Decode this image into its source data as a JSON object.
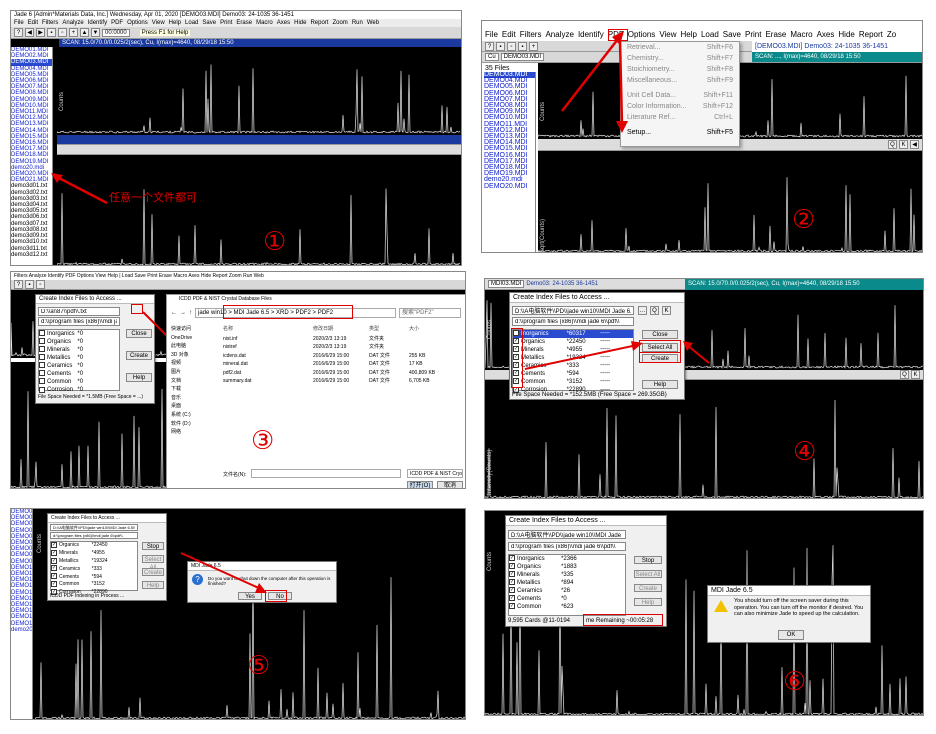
{
  "colors": {
    "annotation": "#e00000",
    "plot_bg": "#000000",
    "list_selected": "#2a4bd0"
  },
  "icons": [
    "red-arrow-icon",
    "warning-icon",
    "question-icon",
    "folder-icon",
    "checkbox-icon"
  ],
  "p1": {
    "title": "Jade 6 [Admin*Materials Data, Inc.] Wednesday, Apr 01, 2020 [DEMO03.MDI] Demo03: 24-1035 36-1451",
    "menu": [
      "File",
      "Edit",
      "Filters",
      "Analyze",
      "Identify",
      "PDF",
      "Options",
      "View",
      "Help",
      "Load",
      "Save",
      "Print",
      "Erase",
      "Macro",
      "Axes",
      "Hide",
      "Report",
      "Zoom",
      "Run",
      "Web"
    ],
    "zoom": "00:0000",
    "hint": "Press F1 for Help",
    "scan": "SCAN: 15.0/70.0/0.025/2(sec), Cu, I(max)=4640, 08/29/18 15:50",
    "files": [
      "DEMO01.MDI",
      "DEMO02.MDI",
      "DEMO03.MDI",
      "DEMO04.MDI",
      "DEMO05.MDI",
      "DEMO06.MDI",
      "DEMO07.MDI",
      "DEMO08.MDI",
      "DEMO09.MDI",
      "DEMO10.MDI",
      "DEMO11.MDI",
      "DEMO12.MDI",
      "DEMO13.MDI",
      "DEMO14.MDI",
      "DEMO15.MDI",
      "DEMO16.MDI",
      "DEMO17.MDI",
      "DEMO18.MDI",
      "DEMO19.MDI",
      "demo20.mdi",
      "DEMO20.MDI",
      "DEMO21.MDI",
      "demo3d01.txt",
      "demo3d02.txt",
      "demo3d03.txt",
      "demo3d04.txt",
      "demo3d05.txt",
      "demo3d06.txt",
      "demo3d07.txt",
      "demo3d08.txt",
      "demo3d09.txt",
      "demo3d10.txt",
      "demo3d11.txt",
      "demo3d12.txt"
    ],
    "ylabel": "Counts",
    "annotation": "任意一个文件都可",
    "step": "①"
  },
  "p2": {
    "menu": [
      "File",
      "Edit",
      "Filters",
      "Analyze",
      "Identify",
      "PDF",
      "Options",
      "View",
      "Help",
      "Load",
      "Save",
      "Print",
      "Erase",
      "Macro",
      "Axes",
      "Hide",
      "Report",
      "Zo"
    ],
    "combo": "Cu",
    "file_combo": "DEMO03.MDI",
    "title": "[DEMO03.MDI] Demo03: 24-1035 36-1451",
    "scan": "SCAN: ..., I(max)=4640, 08/29/18 15:50",
    "count": "35 Files",
    "files": [
      "DEMO03.MDI",
      "DEMO04.MDI",
      "DEMO05.MDI",
      "DEMO06.MDI",
      "DEMO07.MDI",
      "DEMO08.MDI",
      "DEMO09.MDI",
      "DEMO10.MDI",
      "DEMO11.MDI",
      "DEMO12.MDI",
      "DEMO13.MDI",
      "DEMO14.MDI",
      "DEMO15.MDI",
      "DEMO16.MDI",
      "DEMO17.MDI",
      "DEMO18.MDI",
      "DEMO19.MDI",
      "demo20.mdi",
      "DEMO20.MDI"
    ],
    "pdf_menu": [
      {
        "label": "Retrieval...",
        "key": "Shift+F6"
      },
      {
        "label": "Chemistry...",
        "key": "Shift+F7"
      },
      {
        "label": "Stoichiometry...",
        "key": "Shift+F8"
      },
      {
        "label": "Miscellaneous...",
        "key": "Shift+F9"
      },
      {
        "label": "Unit Cell Data...",
        "key": "Shift+F11"
      },
      {
        "label": "Color Information...",
        "key": "Shift+F12"
      },
      {
        "label": "Literature Ref...",
        "key": "Ctrl+L"
      },
      {
        "label": "Setup...",
        "key": "Shift+F5"
      }
    ],
    "ylabel": "Counts",
    "ylabel2": "Sqrt(Counts)",
    "step": "②"
  },
  "p3": {
    "menu": "Filters  Analyze  Identify  PDF  Options  View  Help  |  Load  Save  Print  Erase  Macro  Axes  Hide  Report  Zoom  Run  Web",
    "dialog_title": "Create Index Files to Access ...",
    "path1": "D:\\\\a\\\\87\\\\pdf\\\\.txt",
    "path2": "d:\\\\program files (x86)\\\\mdi jade 6\\\\pdf\\\\",
    "categories": [
      "Inorganics",
      "Organics",
      "Minerals",
      "Metallics",
      "Ceramics",
      "Cements",
      "Common",
      "Corrosion"
    ],
    "values": [
      "*0",
      "*0",
      "*0",
      "*0",
      "*0",
      "*0",
      "*0",
      "*0"
    ],
    "close": "Close",
    "create": "Create",
    "help": "Help",
    "space": "File Space Needed = *1.5MB (Free Space = ...)",
    "explorer_title": "ICDD PDF & NIST Crystal Database Files",
    "breadcrumb": "jade win10 > MDI Jade 6.5 > XRD > PDF2 > PDF2",
    "search": "搜索\"PDF2\"",
    "col_name": "名称",
    "col_date": "修改日期",
    "col_type": "类型",
    "col_size": "大小",
    "sidebar": [
      "快速访问",
      "OneDrive",
      "此电脑",
      "3D 对象",
      "视频",
      "图片",
      "文档",
      "下载",
      "音乐",
      "桌面",
      "系统 (C:)",
      "软件 (D:)",
      "网络"
    ],
    "rows": [
      {
        "name": "nist.inf",
        "date": "2020/2/3 13:19",
        "type": "文件夹",
        "size": ""
      },
      {
        "name": "nistref",
        "date": "2020/2/3 13:19",
        "type": "文件夹",
        "size": ""
      },
      {
        "name": "icdens.dat",
        "date": "2016/6/29 15:00",
        "type": "DAT 文件",
        "size": "255 KB"
      },
      {
        "name": "mineral.dat",
        "date": "2016/6/29 15:00",
        "type": "DAT 文件",
        "size": "17 KB"
      },
      {
        "name": "pdf2.dat",
        "date": "2016/6/29 15:00",
        "type": "DAT 文件",
        "size": "400,809 KB"
      },
      {
        "name": "summary.dat",
        "date": "2016/6/29 15:00",
        "type": "DAT 文件",
        "size": "6,705 KB"
      }
    ],
    "filename_label": "文件名(N):",
    "filter": "ICDD PDF & NIST Crystal Da",
    "open": "打开(O)",
    "cancel": "取消",
    "step": "③"
  },
  "p4": {
    "file_combo": "MDI03.MDI",
    "title": "Demo03: 24-1035 36-1451",
    "scan": "SCAN: 15.0/70.0/0.025/2(sec), Cu, I(max)=4640, 08/29/18 15:50",
    "dialog_title": "Create Index Files to Access ...",
    "path1": "D:\\\\A电脑软件\\\\PD\\\\jade win10\\\\MDI Jade 6.5\\\\X",
    "path2": "d:\\\\program files (x86)\\\\mdi jade 6\\\\pdf\\\\",
    "categories": [
      "Inorganics",
      "Organics",
      "Minerals",
      "Metallics",
      "Ceramics",
      "Cements",
      "Common",
      "Corrosion"
    ],
    "values": [
      "*60317",
      "*22450",
      "*4955",
      "*19324",
      "*333",
      "*594",
      "*3152",
      "*22890"
    ],
    "blanks": [
      "-----",
      "-----",
      "-----",
      "-----",
      "-----",
      "-----",
      "-----",
      "-----"
    ],
    "close": "Close",
    "select_all": "Select All",
    "create": "Create",
    "help": "Help",
    "space": "File Space Needed = *152.5MB (Free Space = 269.35GB)",
    "ylabel": "Counts",
    "ylabel2": "Intensity(Counts)",
    "step": "④"
  },
  "p5": {
    "dialog_title": "Create Index Files to Access ...",
    "path1": "D:\\\\A电脑软件\\\\PD\\\\jade win10\\\\MDI Jade 6.5\\\\X",
    "path2": "d:\\\\program files (x86)\\\\mdi jade 6\\\\pdf\\\\",
    "categories": [
      "Organics",
      "Minerals",
      "Metallics",
      "Ceramics",
      "Cements",
      "Common",
      "Corrosion"
    ],
    "values": [
      "*22450",
      "*4955",
      "*19324",
      "*333",
      "*594",
      "*3152",
      "*22890"
    ],
    "buttons": [
      "Stop",
      "Select All",
      "Create",
      "Help"
    ],
    "status": "ICDD PDF Indexing in Process ...",
    "msg_title": "MDI Jade 6.5",
    "msg_text": "Do you want to shut down the computer after this operation is finished?",
    "yes": "Yes",
    "no": "No",
    "ylabel": "Counts",
    "step": "⑤"
  },
  "p6": {
    "dialog_title": "Create Index Files to Access ...",
    "path1": "D:\\\\A电脑软件\\\\PD\\\\jade win10\\\\MDI Jade 6.5\\\\X",
    "path2": "d:\\\\program files (x86)\\\\mdi jade 6\\\\pdf\\\\",
    "categories": [
      "Inorganics",
      "Organics",
      "Minerals",
      "Metallics",
      "Ceramics",
      "Cements",
      "Common"
    ],
    "values": [
      "*2366",
      "*1883",
      "*335",
      "*894",
      "*26",
      "*0",
      "*623"
    ],
    "buttons": [
      "Stop",
      "Select All",
      "Create",
      "Help"
    ],
    "status_left": "9,595 Cards @11-0194",
    "status_right": "me Remaining ~00:05:28",
    "msg_title": "MDI Jade 6.5",
    "msg_text": "You should turn off the screen saver during this operation. You can turn off the monitor if desired. You can also minimize Jade to speed up the calculation.",
    "ok": "OK",
    "ylabel": "Counts",
    "step": "⑥"
  }
}
